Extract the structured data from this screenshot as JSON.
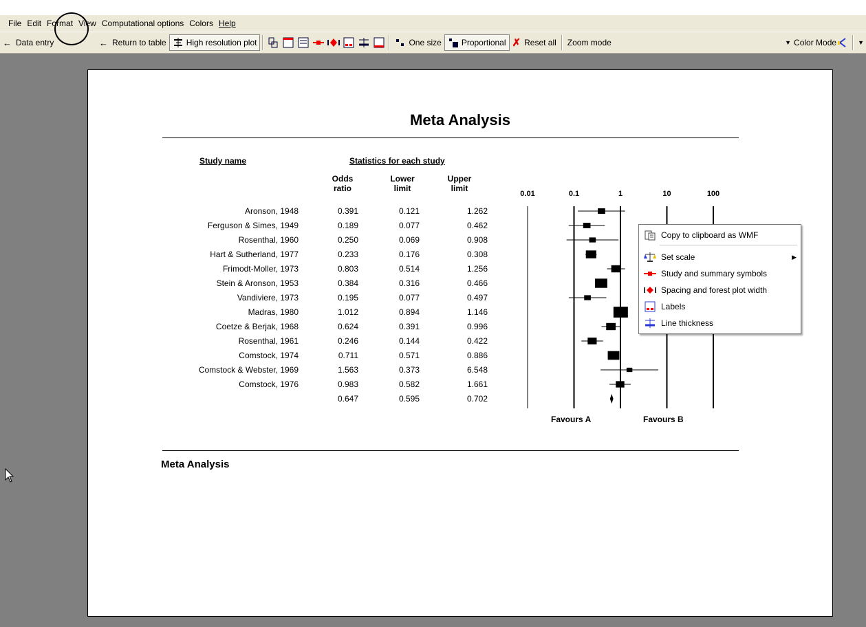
{
  "menubar": {
    "items": [
      "File",
      "Edit",
      "Format",
      "View",
      "Computational options",
      "Colors",
      "Help"
    ]
  },
  "toolbar": {
    "data_entry": "Data entry",
    "return_to_table": "Return to table",
    "high_resolution_plot": "High resolution plot",
    "one_size": "One size",
    "proportional": "Proportional",
    "reset_all": "Reset all",
    "zoom_mode": "Zoom mode",
    "color_mode": "Color Mode"
  },
  "report": {
    "title": "Meta Analysis",
    "study_header": "Study name",
    "stats_header": "Statistics for each study",
    "col_or": [
      "Odds",
      "ratio"
    ],
    "col_lower": [
      "Lower",
      "limit"
    ],
    "col_upper": [
      "Upper",
      "limit"
    ],
    "favours_a": "Favours A",
    "favours_b": "Favours B",
    "footer": "Meta Analysis"
  },
  "context_menu": {
    "items": [
      "Copy to clipboard as WMF",
      "Set scale",
      "Study and summary symbols",
      "Spacing and forest plot width",
      "Labels",
      "Line thickness"
    ]
  },
  "chart_data": {
    "type": "forest",
    "x_scale": "log",
    "x_ticks": [
      "0.01",
      "0.1",
      "1",
      "10",
      "100"
    ],
    "x_tick_values": [
      0.01,
      0.1,
      1,
      10,
      100
    ],
    "studies": [
      {
        "name": "Aronson, 1948",
        "or": "0.391",
        "lower": "0.121",
        "upper": "1.262",
        "weight": 0.4
      },
      {
        "name": "Ferguson & Simes, 1949",
        "or": "0.189",
        "lower": "0.077",
        "upper": "0.462",
        "weight": 0.4
      },
      {
        "name": "Rosenthal, 1960",
        "or": "0.250",
        "lower": "0.069",
        "upper": "0.908",
        "weight": 0.3
      },
      {
        "name": "Hart & Sutherland, 1977",
        "or": "0.233",
        "lower": "0.176",
        "upper": "0.308",
        "weight": 1.0
      },
      {
        "name": "Frimodt-Moller, 1973",
        "or": "0.803",
        "lower": "0.514",
        "upper": "1.256",
        "weight": 0.8
      },
      {
        "name": "Stein & Aronson, 1953",
        "or": "0.384",
        "lower": "0.316",
        "upper": "0.466",
        "weight": 1.5
      },
      {
        "name": "Vandiviere, 1973",
        "or": "0.195",
        "lower": "0.077",
        "upper": "0.497",
        "weight": 0.3
      },
      {
        "name": "Madras, 1980",
        "or": "1.012",
        "lower": "0.894",
        "upper": "1.146",
        "weight": 2.2
      },
      {
        "name": "Coetze & Berjak, 1968",
        "or": "0.624",
        "lower": "0.391",
        "upper": "0.996",
        "weight": 0.8
      },
      {
        "name": "Rosenthal, 1961",
        "or": "0.246",
        "lower": "0.144",
        "upper": "0.422",
        "weight": 0.7
      },
      {
        "name": "Comstock, 1974",
        "or": "0.711",
        "lower": "0.571",
        "upper": "0.886",
        "weight": 1.3
      },
      {
        "name": "Comstock & Webster, 1969",
        "or": "1.563",
        "lower": "0.373",
        "upper": "6.548",
        "weight": 0.2
      },
      {
        "name": "Comstock, 1976",
        "or": "0.983",
        "lower": "0.582",
        "upper": "1.661",
        "weight": 0.6
      }
    ],
    "summary": {
      "or": "0.647",
      "lower": "0.595",
      "upper": "0.702"
    }
  }
}
